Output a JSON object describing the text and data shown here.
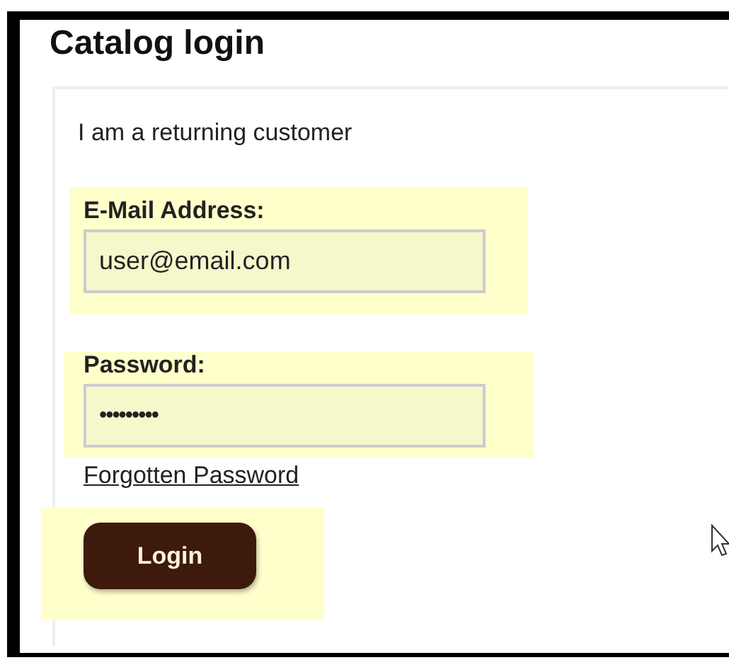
{
  "title": "Catalog login",
  "panel": {
    "heading": "I am a returning customer",
    "fields": [
      {
        "label": "E-Mail Address:",
        "value": "user@email.com",
        "highlighted": true
      },
      {
        "label": "Password:",
        "value": "•••••••••",
        "highlighted": true
      }
    ],
    "link": "Forgotten Password",
    "button": {
      "label": "Login",
      "highlighted": true
    }
  }
}
